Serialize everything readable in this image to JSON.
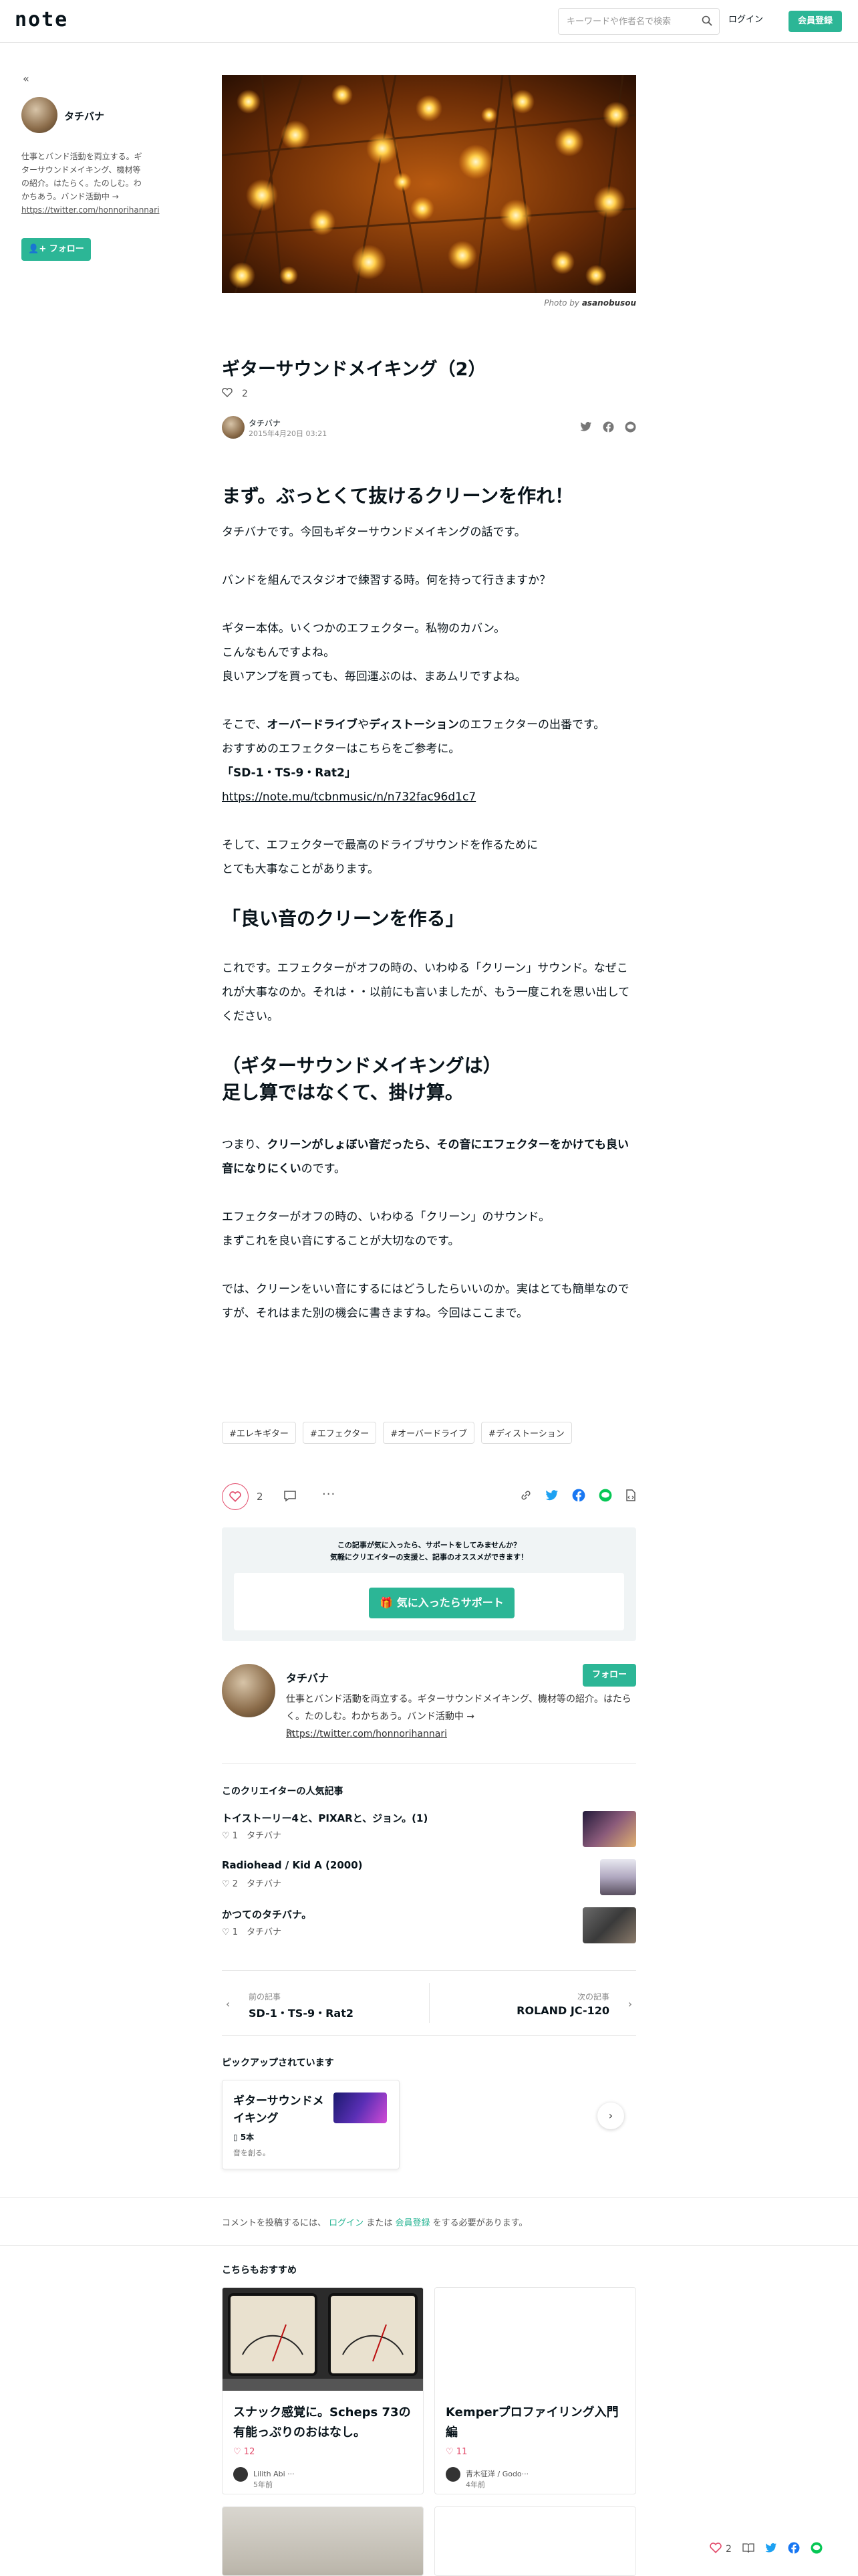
{
  "header": {
    "logo": "note",
    "search_placeholder": "キーワードや作者名で検索",
    "login": "ログイン",
    "signup": "会員登録"
  },
  "sidebar": {
    "author_name": "タチバナ",
    "bio": "仕事とバンド活動を両立する。ギターサウンドメイキング、機材等の紹介。はたらく。たのしむ。わかちあう。バンド活動中 →",
    "bio_link": "https://twitter.com/honnorihannari",
    "follow": "フォロー"
  },
  "article": {
    "photo_prefix": "Photo by",
    "photo_author": "asanobusou",
    "title": "ギターサウンドメイキング（2）",
    "likes": "2",
    "author": "タチバナ",
    "date": "2015年4月20日 03:21",
    "sections": {
      "h1": "まず。ぶっとくて抜けるクリーンを作れ！",
      "p1": "タチバナです。今回もギターサウンドメイキングの話です。",
      "p2": "バンドを組んでスタジオで練習する時。何を持って行きますか？",
      "p3_l1": "ギター本体。いくつかのエフェクター。私物のカバン。",
      "p3_l2": "こんなもんですよね。",
      "p3_l3": "良いアンプを買っても、毎回運ぶのは、まあムリですよね。",
      "p4_a": "そこで、",
      "p4_b": "オーバードライブ",
      "p4_c": "や",
      "p4_d": "ディストーション",
      "p4_e": "のエフェクターの出番です。",
      "p4_l2": "おすすめのエフェクターはこちらをご参考に。",
      "p4_l3": "「SD-1・TS-9・Rat2」",
      "p4_link": "https://note.mu/tcbnmusic/n/n732fac96d1c7",
      "p5_l1": "そして、エフェクターで最高のドライブサウンドを作るために",
      "p5_l2": "とても大事なことがあります。",
      "h2": "「良い音のクリーンを作る」",
      "p6": "これです。エフェクターがオフの時の、いわゆる「クリーン」サウンド。なぜこれが大事なのか。それは・・以前にも言いましたが、もう一度これを思い出してください。",
      "h3_l1": "（ギターサウンドメイキングは）",
      "h3_l2": "足し算ではなくて、掛け算。",
      "p7_a": "つまり、",
      "p7_b": "クリーンがしょぼい音だったら、その音にエフェクターをかけても良い音になりにくい",
      "p7_c": "のです。",
      "p8_l1": "エフェクターがオフの時の、いわゆる「クリーン」のサウンド。",
      "p8_l2": "まずこれを良い音にすることが大切なのです。",
      "p9": "では、クリーンをいい音にするにはどうしたらいいのか。実はとても簡単なのですが、それはまた別の機会に書きますね。今回はここまで。"
    },
    "tags": [
      "#エレキギター",
      "#エフェクター",
      "#オーバードライブ",
      "#ディストーション"
    ],
    "action_likes": "2"
  },
  "support": {
    "line1": "この記事が気に入ったら、サポートをしてみませんか？",
    "line2": "気軽にクリエイターの支援と、記事のオススメができます！",
    "button": "気に入ったらサポート"
  },
  "creator": {
    "name": "タチバナ",
    "follow": "フォロー",
    "bio": "仕事とバンド活動を両立する。ギターサウンドメイキング、機材等の紹介。はたらく。たのしむ。わかちあう。バンド活動中 →",
    "bio_link": "https://twitter.com/honnorihannari"
  },
  "popular": {
    "heading": "このクリエイターの人気記事",
    "items": [
      {
        "title": "トイストーリー4と、PIXARと、ジョン。(1)",
        "likes": "1",
        "author": "タチバナ"
      },
      {
        "title": "Radiohead / Kid A (2000)",
        "likes": "2",
        "author": "タチバナ"
      },
      {
        "title": "かつてのタチバナ。",
        "likes": "1",
        "author": "タチバナ"
      }
    ]
  },
  "nav": {
    "prev_label": "前の記事",
    "prev_title": "SD-1・TS-9・Rat2",
    "next_label": "次の記事",
    "next_title": "ROLAND JC-120"
  },
  "pickup": {
    "heading": "ピックアップされています",
    "card_title": "ギターサウンドメイキング",
    "magazine": "5本",
    "desc": "音を創る。"
  },
  "comment": {
    "prefix": "コメントを投稿するには、",
    "login": "ログイン",
    "or": "または",
    "signup": "会員登録",
    "suffix": "をする必要があります。"
  },
  "recommend": {
    "heading": "こちらもおすすめ",
    "cards": [
      {
        "title": "スナック感覚に。Scheps 73の有能っぷりのおはなし。",
        "likes": "12",
        "author": "Lilith Abi ···",
        "age": "5年前"
      },
      {
        "title": "Kemperプロファイリング入門編",
        "likes": "11",
        "author": "青木征洋 / Godo···",
        "age": "4年前"
      }
    ]
  },
  "floating": {
    "likes": "2"
  }
}
